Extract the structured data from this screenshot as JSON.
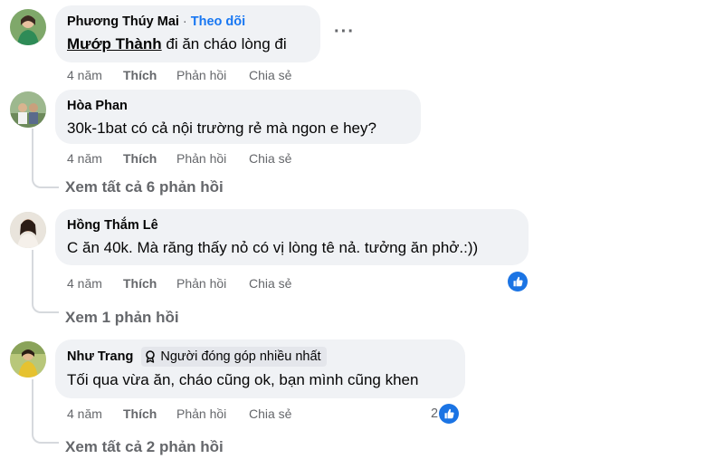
{
  "comments": [
    {
      "author": "Phương Thúy Mai",
      "follow_label": "Theo dõi",
      "mention": "Mướp Thành",
      "text": "đi ăn cháo lòng đi",
      "time": "4 năm",
      "like_label": "Thích",
      "reply_label": "Phản hồi",
      "share_label": "Chia sẻ"
    },
    {
      "author": "Hòa Phan",
      "text": "30k-1bat có cả nội trường rẻ mà ngon e hey?",
      "time": "4 năm",
      "like_label": "Thích",
      "reply_label": "Phản hồi",
      "share_label": "Chia sẻ",
      "view_replies": "Xem tất cả 6 phản hồi"
    },
    {
      "author": "Hồng Thắm Lê",
      "text": "C ăn 40k. Mà răng thấy nỏ có vị lòng tê nả. tưởng ăn phở.:))",
      "time": "4 năm",
      "like_label": "Thích",
      "reply_label": "Phản hồi",
      "share_label": "Chia sẻ",
      "reaction_icon": "like-icon",
      "view_replies": "Xem 1 phản hồi"
    },
    {
      "author": "Như Trang",
      "badge": "Người đóng góp nhiều nhất",
      "badge_icon": "top-contributor-icon",
      "text": "Tối qua vừa ăn, cháo cũng ok, bạn mình cũng khen",
      "time": "4 năm",
      "like_label": "Thích",
      "reply_label": "Phản hồi",
      "share_label": "Chia sẻ",
      "reaction_count": "2",
      "reaction_icon": "like-icon",
      "view_replies": "Xem tất cả 2 phản hồi"
    }
  ],
  "more_icon": "more-options-icon",
  "colors": {
    "bubble": "#f0f2f5",
    "secondary_text": "#65676b",
    "link_blue": "#1877f2",
    "like_blue": "#1b74e4",
    "thread_line": "#d6d9dd"
  }
}
